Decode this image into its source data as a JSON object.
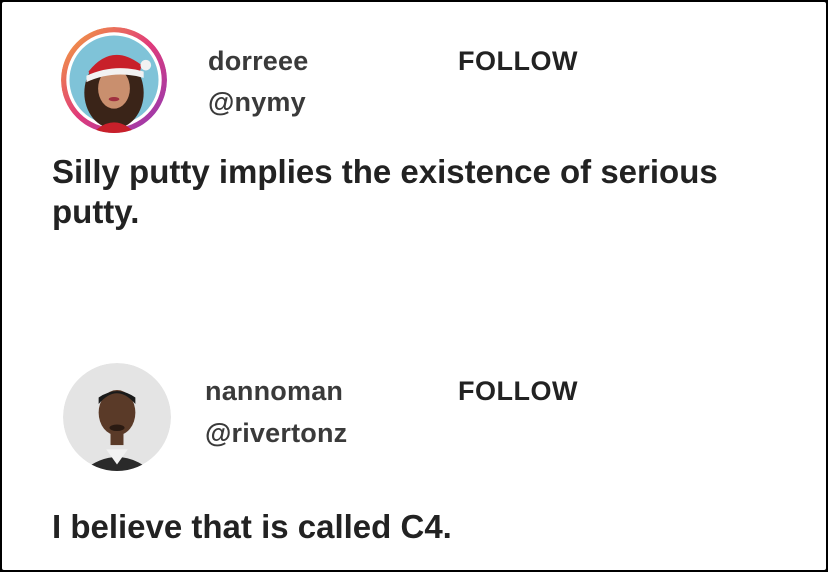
{
  "posts": [
    {
      "username": "dorreee",
      "handle": "@nymy",
      "follow_label": "FOLLOW",
      "text": "Silly putty implies the existence of serious putty.",
      "avatar_ring_color": "#e03a7a"
    },
    {
      "username": "nannoman",
      "handle": "@rivertonz",
      "follow_label": "FOLLOW",
      "text": "I believe that is called C4."
    }
  ]
}
